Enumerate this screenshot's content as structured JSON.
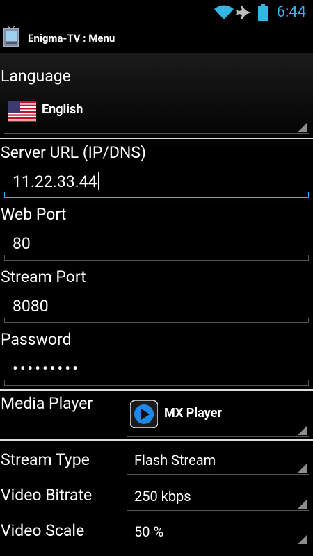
{
  "status": {
    "time": "6:44",
    "icons": [
      "wifi-icon",
      "airplane-icon",
      "battery-icon"
    ],
    "accent_color": "#33b5e5"
  },
  "app": {
    "title": "Enigma-TV : Menu",
    "icon": "tv-app-icon"
  },
  "language": {
    "label": "Language",
    "value": "English",
    "flag": "us-flag-icon"
  },
  "server_url": {
    "label": "Server URL (IP/DNS)",
    "value": "11.22.33.44"
  },
  "web_port": {
    "label": "Web Port",
    "value": "80"
  },
  "stream_port": {
    "label": "Stream Port",
    "value": "8080"
  },
  "password": {
    "label": "Password",
    "value": "•••••••••"
  },
  "media_player": {
    "label": "Media Player",
    "value": "MX Player",
    "icon": "mx-player-icon"
  },
  "stream_type": {
    "label": "Stream Type",
    "value": "Flash Stream"
  },
  "video_bitrate": {
    "label": "Video Bitrate",
    "value": "250 kbps"
  },
  "video_scale": {
    "label": "Video Scale",
    "value": "50 %"
  }
}
